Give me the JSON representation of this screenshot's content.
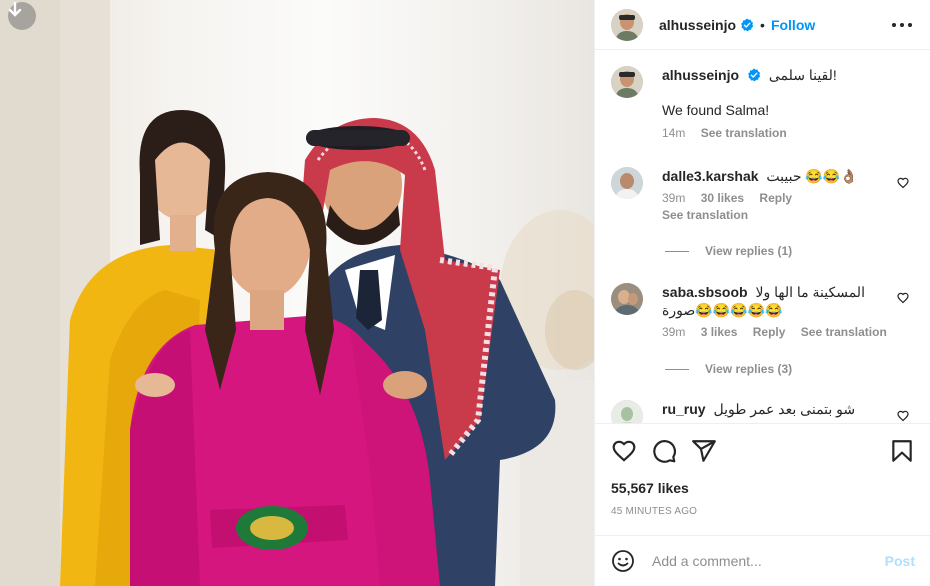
{
  "post": {
    "author": "alhusseinjo",
    "follow_label": "Follow",
    "separator": "•",
    "verified": true
  },
  "caption": {
    "username": "alhusseinjo",
    "arabic": "لقينا سلمى!",
    "english": "We found Salma!",
    "time": "14m",
    "see_translation": "See translation"
  },
  "comments": [
    {
      "username": "dalle3.karshak",
      "text": "حبيبت 😂😂👌🏽",
      "time": "39m",
      "likes": "30 likes",
      "reply": "Reply",
      "see_translation": "See translation",
      "view_replies": "View replies (1)"
    },
    {
      "username": "saba.sbsoob",
      "text_line1": "المسكينة ما الها ولا",
      "text_line2": "صورة😂😂😂😂😂",
      "time": "39m",
      "likes": "3 likes",
      "reply": "Reply",
      "see_translation": "See translation",
      "view_replies": "View replies (3)"
    },
    {
      "username": "ru_ruy",
      "text": "شو بتمنى بعد عمر طويل"
    }
  ],
  "engagement": {
    "likes": "55,567 likes",
    "timestamp": "45 MINUTES AGO"
  },
  "comment_box": {
    "placeholder": "Add a comment...",
    "post_label": "Post"
  },
  "colors": {
    "accent": "#0095f6",
    "post_disabled": "#b2dffc",
    "muted": "#8e8e8e"
  },
  "icons": [
    "download-icon",
    "verified-icon",
    "more-icon",
    "heart-icon",
    "comment-icon",
    "share-icon",
    "bookmark-icon",
    "emoji-icon"
  ]
}
